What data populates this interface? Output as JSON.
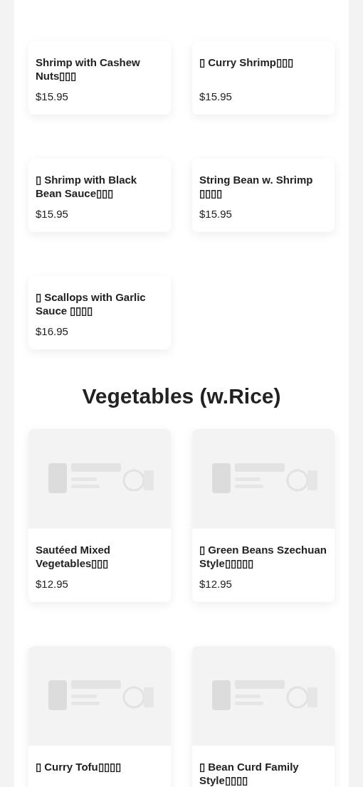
{
  "sections": [
    {
      "items": [
        {
          "name": "Shrimp with Cashew Nuts▯▯▯",
          "price": "$15.95",
          "image": false
        },
        {
          "name": "▯ Curry Shrimp▯▯▯",
          "price": "$15.95",
          "image": false
        },
        {
          "name": "▯ Shrimp with Black Bean Sauce▯▯▯",
          "price": "$15.95",
          "image": false
        },
        {
          "name": "String Bean w. Shrimp ▯▯▯▯",
          "price": "$15.95",
          "image": false
        },
        {
          "name": "▯ Scallops with Garlic Sauce ▯▯▯▯",
          "price": "$16.95",
          "image": false
        }
      ]
    },
    {
      "heading": "Vegetables (w.Rice)",
      "items": [
        {
          "name": "Sautéed Mixed Vegetables▯▯▯",
          "price": "$12.95",
          "image": true
        },
        {
          "name": "▯ Green Beans Szechuan Style▯▯▯▯▯",
          "price": "$12.95",
          "image": true
        },
        {
          "name": "▯ Curry Tofu▯▯▯▯",
          "image": true
        },
        {
          "name": "▯ Bean Curd Family Style▯▯▯▯",
          "image": true
        }
      ]
    }
  ]
}
